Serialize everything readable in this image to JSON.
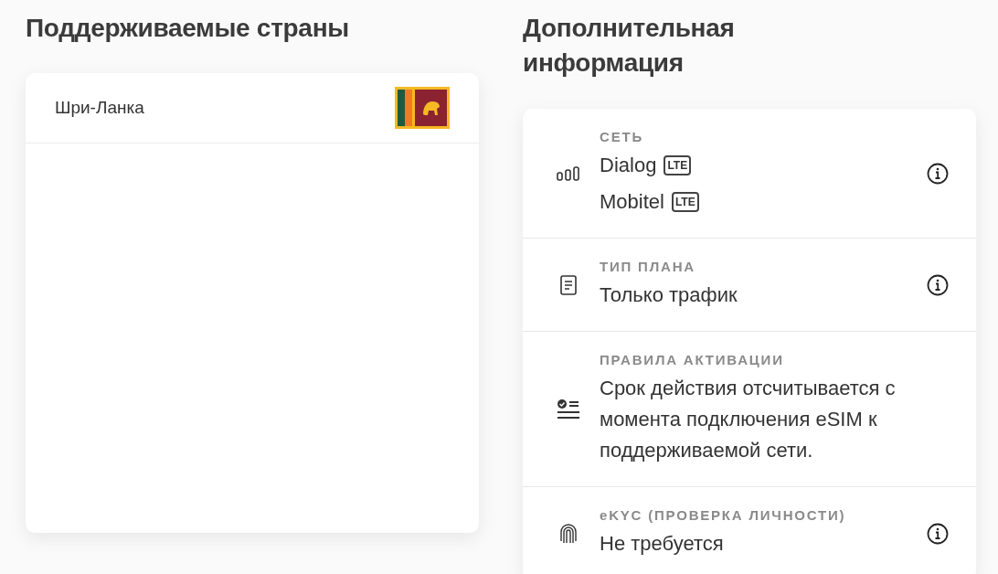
{
  "countries_section": {
    "title": "Поддерживаемые страны",
    "countries": [
      {
        "name": "Шри-Ланка"
      }
    ]
  },
  "info_section": {
    "title": "Дополнительная информация",
    "rows": [
      {
        "kind": "network",
        "label": "СЕТЬ",
        "networks": [
          {
            "name": "Dialog",
            "badge": "LTE"
          },
          {
            "name": "Mobitel",
            "badge": "LTE"
          }
        ],
        "info": true
      },
      {
        "kind": "plan",
        "label": "ТИП ПЛАНА",
        "value": "Только трафик",
        "info": true
      },
      {
        "kind": "activation",
        "label": "ПРАВИЛА АКТИВАЦИИ",
        "value": "Срок действия отсчитывается с момента подключения eSIM к поддерживаемой сети.",
        "info": false
      },
      {
        "kind": "ekyc",
        "label": "eKYC (ПРОВЕРКА ЛИЧНОСТИ)",
        "value": "Не требуется",
        "info": true
      }
    ]
  }
}
